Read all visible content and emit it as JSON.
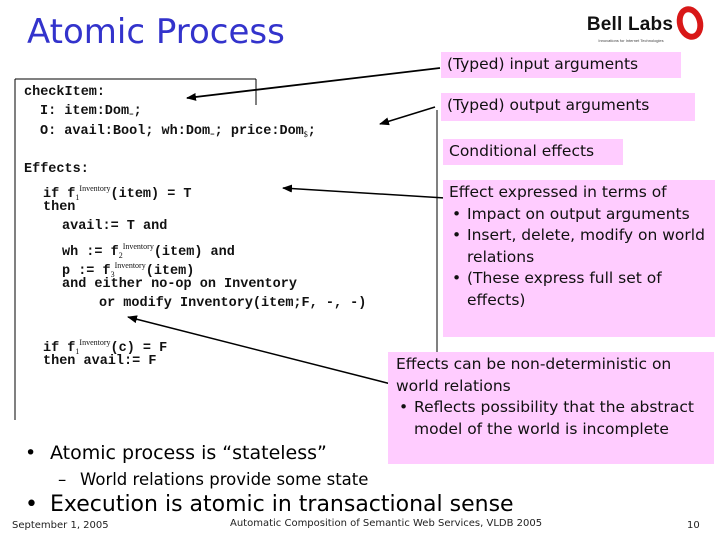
{
  "slide": {
    "title": "Atomic Process",
    "logo": {
      "name": "Bell Labs",
      "tagline": "Innovations for Internet Technologies"
    }
  },
  "code": {
    "header": "checkItem:",
    "input_line": "I: item:Dom",
    "input_sub": "=",
    "input_end": ";",
    "output_line_a": "O: avail:Bool; wh:Dom",
    "output_sub_a": "=",
    "output_line_b": "; price:Dom",
    "output_sub_b": "$",
    "output_end": ";",
    "effects_header": "Effects:",
    "lines": [
      {
        "pre": "if f",
        "sub": "1",
        "sup": "Inventory",
        "post": "(item) = T"
      },
      {
        "text": "then"
      },
      {
        "text": "avail:= T and"
      },
      {
        "pre": "wh := f",
        "sub": "2",
        "sup": "Inventory",
        "post": "(item) and"
      },
      {
        "pre": "p := f",
        "sub": "3",
        "sup": "Inventory",
        "post": "(item)"
      },
      {
        "text": "and either no-op on Inventory"
      },
      {
        "text": "or modify Inventory(item;F, -, -)"
      },
      {
        "pre": "if f",
        "sub": "1",
        "sup": "Inventory",
        "post": "(c) = F"
      },
      {
        "text": "then avail:= F"
      }
    ]
  },
  "callouts": {
    "input_args": "(Typed) input arguments",
    "output_args": "(Typed) output arguments",
    "conditional": "Conditional effects",
    "effect_terms": {
      "heading": "Effect expressed in terms of",
      "items": [
        "Impact on output arguments",
        "Insert, delete, modify on world relations",
        "(These express full set of effects)"
      ]
    },
    "nondeterministic": {
      "heading": "Effects can be non-deterministic on world relations",
      "items": [
        "Reflects possibility that the abstract model of the world is incomplete"
      ]
    }
  },
  "bullets": [
    {
      "text": "Atomic process is “stateless”"
    },
    {
      "text": "World relations provide some state"
    },
    {
      "text": "Execution is atomic in transactional sense"
    }
  ],
  "bullet_symbols": {
    "bullet": "•",
    "dash": "–"
  },
  "footer": {
    "date": "September 1, 2005",
    "title": "Automatic Composition of Semantic Web Services, VLDB 2005",
    "page": "10"
  },
  "colors": {
    "title": "#3333cc",
    "callout_bg": "#ffccff",
    "logo_ring": "#d81818"
  }
}
